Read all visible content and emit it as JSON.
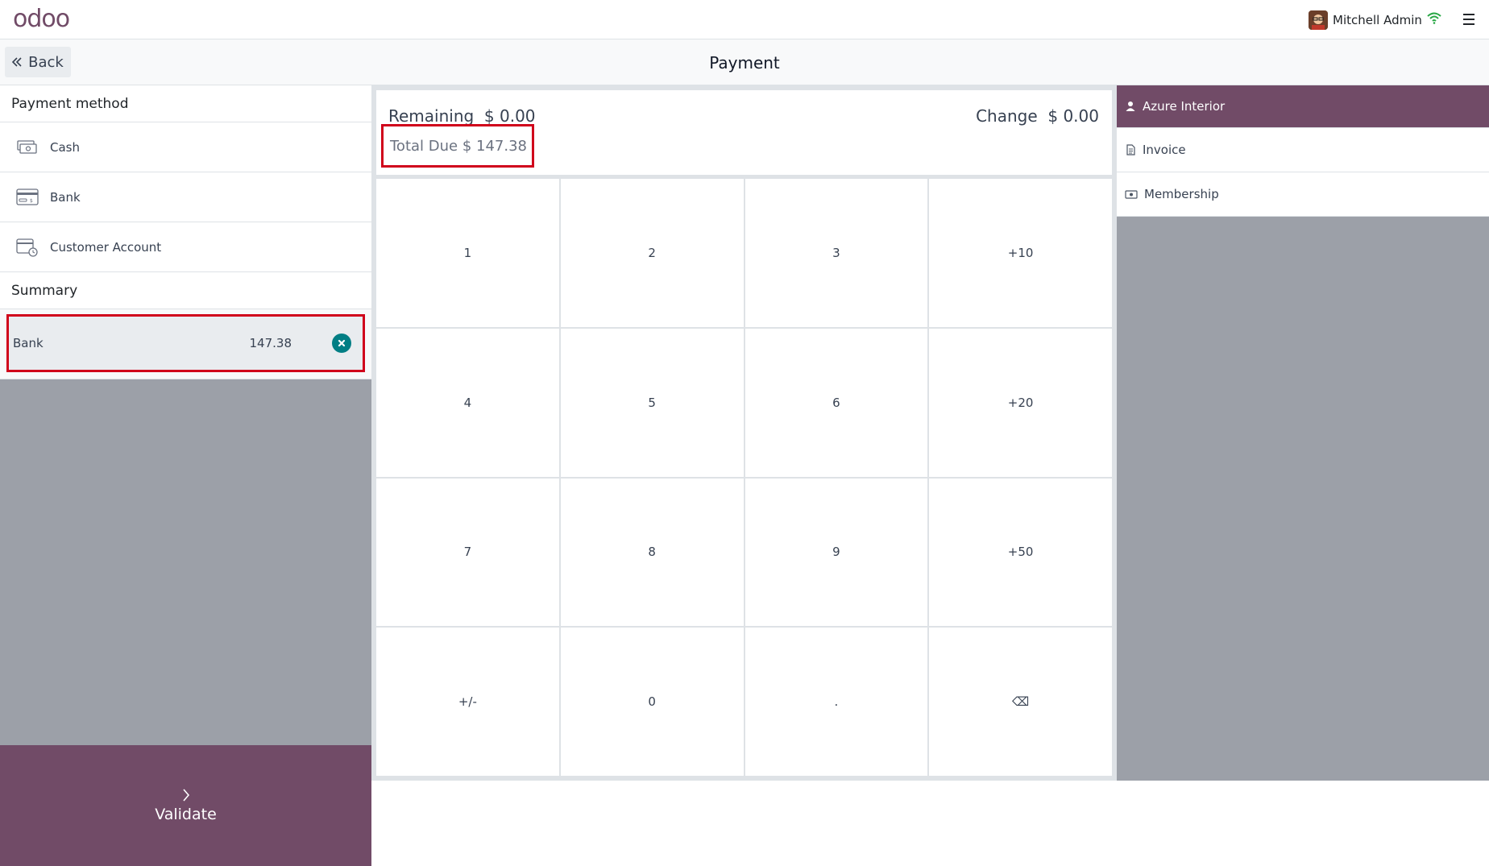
{
  "header": {
    "logo_text": "odoo",
    "user_name": "Mitchell Admin"
  },
  "subheader": {
    "back_label": "Back",
    "title": "Payment"
  },
  "payment_methods": {
    "title": "Payment method",
    "items": [
      {
        "label": "Cash",
        "icon": "cash-icon"
      },
      {
        "label": "Bank",
        "icon": "bank-card-icon"
      },
      {
        "label": "Customer Account",
        "icon": "customer-account-icon"
      }
    ]
  },
  "summary": {
    "title": "Summary",
    "lines": [
      {
        "method": "Bank",
        "amount": "147.38"
      }
    ]
  },
  "validate": {
    "label": "Validate"
  },
  "status": {
    "remaining_label": "Remaining",
    "remaining_value": "$ 0.00",
    "change_label": "Change",
    "change_value": "$ 0.00",
    "total_due_label": "Total Due",
    "total_due_value": "$ 147.38"
  },
  "numpad": {
    "keys": [
      "1",
      "2",
      "3",
      "+10",
      "4",
      "5",
      "6",
      "+20",
      "7",
      "8",
      "9",
      "+50",
      "+/-",
      "0",
      ".",
      "⌫"
    ]
  },
  "right_panel": {
    "customer": "Azure Interior",
    "invoice_label": "Invoice",
    "membership_label": "Membership"
  },
  "colors": {
    "brand": "#714b67",
    "highlight": "#d0021b",
    "teal": "#017e84"
  }
}
